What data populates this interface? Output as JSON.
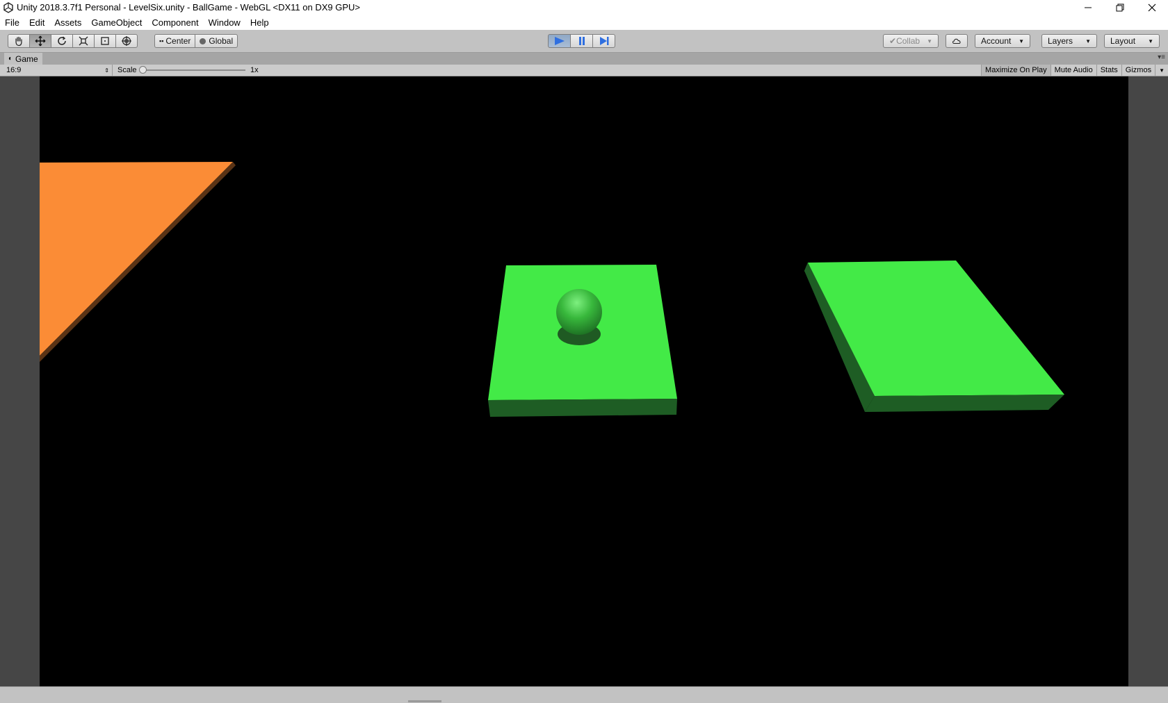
{
  "window": {
    "title": "Unity 2018.3.7f1 Personal - LevelSix.unity - BallGame - WebGL <DX11 on DX9 GPU>"
  },
  "menu": {
    "items": [
      "File",
      "Edit",
      "Assets",
      "GameObject",
      "Component",
      "Window",
      "Help"
    ]
  },
  "toolbar": {
    "transform_tools": [
      "hand-icon",
      "move-icon",
      "rotate-icon",
      "scale-icon",
      "rect-tool-icon",
      "transform-tool-icon"
    ],
    "pivot_label": "Center",
    "space_label": "Global",
    "playback": [
      "play-icon",
      "pause-icon",
      "step-icon"
    ],
    "collab_label": "Collab",
    "account_label": "Account",
    "layers_label": "Layers",
    "layout_label": "Layout"
  },
  "game_view": {
    "tab_label": "Game",
    "aspect": "16:9",
    "scale_label": "Scale",
    "scale_value": "1x",
    "maximize_label": "Maximize On Play",
    "mute_label": "Mute Audio",
    "stats_label": "Stats",
    "gizmos_label": "Gizmos"
  },
  "colors": {
    "platform_top": "#43ea47",
    "platform_side": "#1e5d24",
    "orange_platform": "#fb8c36",
    "orange_edge": "#5a3315",
    "ball": "#2f9d35",
    "play_active": "#2f6fe0"
  }
}
